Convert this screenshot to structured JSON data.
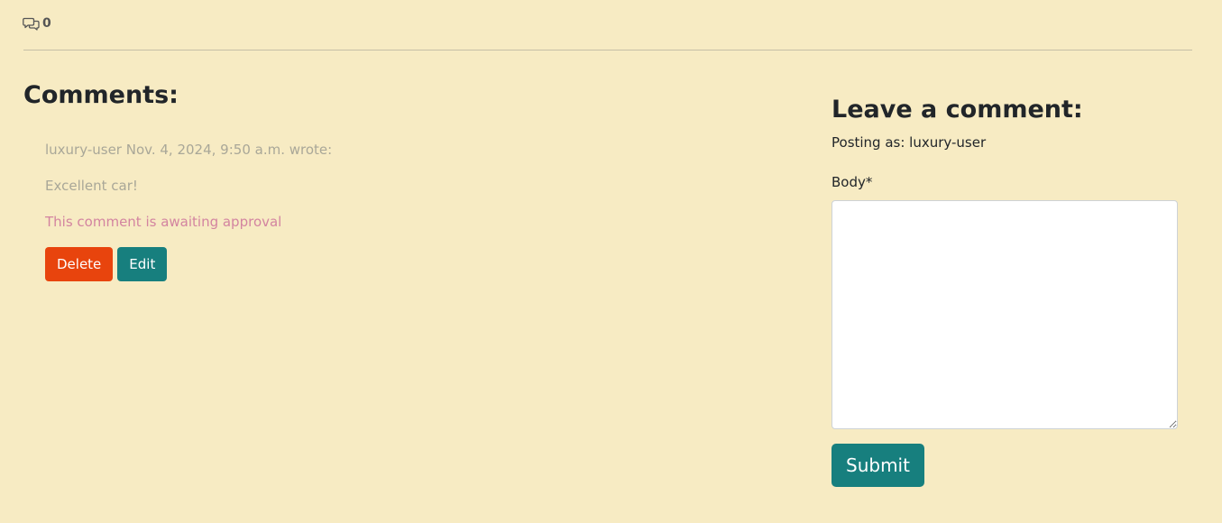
{
  "header": {
    "comment_icon": "chat-bubbles-icon",
    "comment_count": "0"
  },
  "comments_section": {
    "title": "Comments:",
    "comments": [
      {
        "meta": "luxury-user Nov. 4, 2024, 9:50 a.m. wrote:",
        "body": "Excellent car!",
        "status": "This comment is awaiting approval",
        "delete_label": "Delete",
        "edit_label": "Edit"
      }
    ]
  },
  "form": {
    "title": "Leave a comment:",
    "posting_as": "Posting as: luxury-user",
    "body_label": "Body*",
    "body_value": "",
    "submit_label": "Submit"
  },
  "colors": {
    "background": "#f7ebc3",
    "delete_button": "#e8440d",
    "primary_teal": "#177f7e",
    "awaiting_text": "#d384a0",
    "muted_text": "#a9a798"
  }
}
